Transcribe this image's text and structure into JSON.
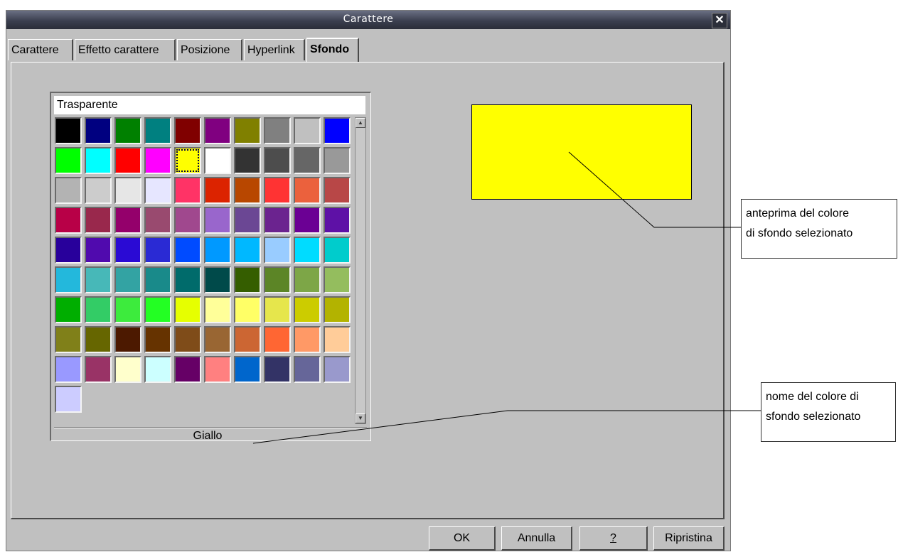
{
  "window": {
    "title": "Carattere",
    "close_glyph": "✕"
  },
  "tabs": [
    {
      "label": "Carattere",
      "active": false
    },
    {
      "label": "Effetto carattere",
      "active": false
    },
    {
      "label": "Posizione",
      "active": false
    },
    {
      "label": "Hyperlink",
      "active": false
    },
    {
      "label": "Sfondo",
      "active": true
    }
  ],
  "palette": {
    "transparent_label": "Trasparente",
    "selected_name": "Giallo",
    "selected_index": 14,
    "colors": [
      "#000000",
      "#000080",
      "#008000",
      "#008080",
      "#800000",
      "#800080",
      "#808000",
      "#808080",
      "#c0c0c0",
      "#0000ff",
      "#00ff00",
      "#00ffff",
      "#ff0000",
      "#ff00ff",
      "#ffff00",
      "#ffffff",
      "#333333",
      "#4d4d4d",
      "#666666",
      "#999999",
      "#b3b3b3",
      "#cccccc",
      "#e6e6e6",
      "#e6e6ff",
      "#ff3366",
      "#dc2300",
      "#b84700",
      "#ff3333",
      "#eb613d",
      "#b84747",
      "#b80047",
      "#99284c",
      "#94006b",
      "#994a6f",
      "#a0488e",
      "#9966cc",
      "#6b4794",
      "#6b238f",
      "#6b0094",
      "#5e11a6",
      "#28009b",
      "#500aae",
      "#2a0ad4",
      "#2a2ad4",
      "#004bff",
      "#0099ff",
      "#00b8ff",
      "#99ccff",
      "#00dcff",
      "#00cccc",
      "#23b8dc",
      "#47b8b8",
      "#33a3a3",
      "#198a8a",
      "#006b6b",
      "#004a4a",
      "#355e00",
      "#5c8526",
      "#7da647",
      "#94bd5e",
      "#00ae00",
      "#33cc66",
      "#3deb3d",
      "#23ff23",
      "#e6ff00",
      "#ffff99",
      "#ffff66",
      "#e6e64c",
      "#cccc00",
      "#b3b300",
      "#808019",
      "#666600",
      "#4c1900",
      "#663300",
      "#7f4c19",
      "#996633",
      "#cc6633",
      "#ff6633",
      "#ff9966",
      "#ffcc99",
      "#9999ff",
      "#993366",
      "#ffffcc",
      "#ccffff",
      "#660066",
      "#ff8080",
      "#0066cc",
      "#333366",
      "#666699",
      "#9999cc",
      "#ccccff"
    ]
  },
  "preview": {
    "color": "#ffff00"
  },
  "annotations": {
    "preview_note_line1": "anteprima del  colore",
    "preview_note_line2": "di sfondo selezionato",
    "name_note_line1": "nome del colore di",
    "name_note_line2": "sfondo selezionato"
  },
  "buttons": {
    "ok": "OK",
    "cancel": "Annulla",
    "help": "?",
    "reset": "Ripristina"
  },
  "icons": {
    "scroll_up": "scroll-up-arrow-icon",
    "scroll_down": "scroll-down-arrow-icon"
  }
}
